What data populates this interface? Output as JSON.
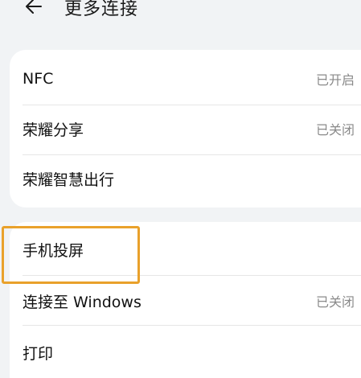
{
  "header": {
    "title": "更多连接",
    "back_icon": "arrow-left-icon"
  },
  "group1": {
    "items": [
      {
        "label": "NFC",
        "value": "已开启"
      },
      {
        "label": "荣耀分享",
        "value": "已关闭"
      },
      {
        "label": "荣耀智慧出行",
        "value": ""
      }
    ]
  },
  "group2": {
    "items": [
      {
        "label": "手机投屏",
        "value": ""
      },
      {
        "label": "连接至 Windows",
        "value": "已关闭"
      },
      {
        "label": "打印",
        "value": ""
      }
    ]
  },
  "colors": {
    "highlight": "#e9a12b",
    "background": "#f1f3f5",
    "card": "#ffffff"
  }
}
